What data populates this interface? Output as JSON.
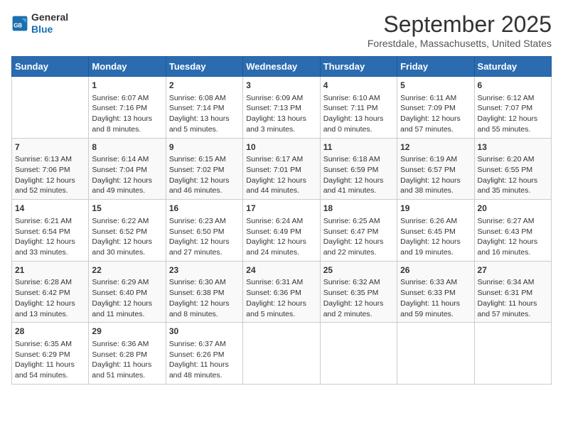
{
  "header": {
    "logo_line1": "General",
    "logo_line2": "Blue",
    "month_title": "September 2025",
    "location": "Forestdale, Massachusetts, United States"
  },
  "days_of_week": [
    "Sunday",
    "Monday",
    "Tuesday",
    "Wednesday",
    "Thursday",
    "Friday",
    "Saturday"
  ],
  "weeks": [
    [
      {
        "day": "",
        "info": ""
      },
      {
        "day": "1",
        "info": "Sunrise: 6:07 AM\nSunset: 7:16 PM\nDaylight: 13 hours\nand 8 minutes."
      },
      {
        "day": "2",
        "info": "Sunrise: 6:08 AM\nSunset: 7:14 PM\nDaylight: 13 hours\nand 5 minutes."
      },
      {
        "day": "3",
        "info": "Sunrise: 6:09 AM\nSunset: 7:13 PM\nDaylight: 13 hours\nand 3 minutes."
      },
      {
        "day": "4",
        "info": "Sunrise: 6:10 AM\nSunset: 7:11 PM\nDaylight: 13 hours\nand 0 minutes."
      },
      {
        "day": "5",
        "info": "Sunrise: 6:11 AM\nSunset: 7:09 PM\nDaylight: 12 hours\nand 57 minutes."
      },
      {
        "day": "6",
        "info": "Sunrise: 6:12 AM\nSunset: 7:07 PM\nDaylight: 12 hours\nand 55 minutes."
      }
    ],
    [
      {
        "day": "7",
        "info": "Sunrise: 6:13 AM\nSunset: 7:06 PM\nDaylight: 12 hours\nand 52 minutes."
      },
      {
        "day": "8",
        "info": "Sunrise: 6:14 AM\nSunset: 7:04 PM\nDaylight: 12 hours\nand 49 minutes."
      },
      {
        "day": "9",
        "info": "Sunrise: 6:15 AM\nSunset: 7:02 PM\nDaylight: 12 hours\nand 46 minutes."
      },
      {
        "day": "10",
        "info": "Sunrise: 6:17 AM\nSunset: 7:01 PM\nDaylight: 12 hours\nand 44 minutes."
      },
      {
        "day": "11",
        "info": "Sunrise: 6:18 AM\nSunset: 6:59 PM\nDaylight: 12 hours\nand 41 minutes."
      },
      {
        "day": "12",
        "info": "Sunrise: 6:19 AM\nSunset: 6:57 PM\nDaylight: 12 hours\nand 38 minutes."
      },
      {
        "day": "13",
        "info": "Sunrise: 6:20 AM\nSunset: 6:55 PM\nDaylight: 12 hours\nand 35 minutes."
      }
    ],
    [
      {
        "day": "14",
        "info": "Sunrise: 6:21 AM\nSunset: 6:54 PM\nDaylight: 12 hours\nand 33 minutes."
      },
      {
        "day": "15",
        "info": "Sunrise: 6:22 AM\nSunset: 6:52 PM\nDaylight: 12 hours\nand 30 minutes."
      },
      {
        "day": "16",
        "info": "Sunrise: 6:23 AM\nSunset: 6:50 PM\nDaylight: 12 hours\nand 27 minutes."
      },
      {
        "day": "17",
        "info": "Sunrise: 6:24 AM\nSunset: 6:49 PM\nDaylight: 12 hours\nand 24 minutes."
      },
      {
        "day": "18",
        "info": "Sunrise: 6:25 AM\nSunset: 6:47 PM\nDaylight: 12 hours\nand 22 minutes."
      },
      {
        "day": "19",
        "info": "Sunrise: 6:26 AM\nSunset: 6:45 PM\nDaylight: 12 hours\nand 19 minutes."
      },
      {
        "day": "20",
        "info": "Sunrise: 6:27 AM\nSunset: 6:43 PM\nDaylight: 12 hours\nand 16 minutes."
      }
    ],
    [
      {
        "day": "21",
        "info": "Sunrise: 6:28 AM\nSunset: 6:42 PM\nDaylight: 12 hours\nand 13 minutes."
      },
      {
        "day": "22",
        "info": "Sunrise: 6:29 AM\nSunset: 6:40 PM\nDaylight: 12 hours\nand 11 minutes."
      },
      {
        "day": "23",
        "info": "Sunrise: 6:30 AM\nSunset: 6:38 PM\nDaylight: 12 hours\nand 8 minutes."
      },
      {
        "day": "24",
        "info": "Sunrise: 6:31 AM\nSunset: 6:36 PM\nDaylight: 12 hours\nand 5 minutes."
      },
      {
        "day": "25",
        "info": "Sunrise: 6:32 AM\nSunset: 6:35 PM\nDaylight: 12 hours\nand 2 minutes."
      },
      {
        "day": "26",
        "info": "Sunrise: 6:33 AM\nSunset: 6:33 PM\nDaylight: 11 hours\nand 59 minutes."
      },
      {
        "day": "27",
        "info": "Sunrise: 6:34 AM\nSunset: 6:31 PM\nDaylight: 11 hours\nand 57 minutes."
      }
    ],
    [
      {
        "day": "28",
        "info": "Sunrise: 6:35 AM\nSunset: 6:29 PM\nDaylight: 11 hours\nand 54 minutes."
      },
      {
        "day": "29",
        "info": "Sunrise: 6:36 AM\nSunset: 6:28 PM\nDaylight: 11 hours\nand 51 minutes."
      },
      {
        "day": "30",
        "info": "Sunrise: 6:37 AM\nSunset: 6:26 PM\nDaylight: 11 hours\nand 48 minutes."
      },
      {
        "day": "",
        "info": ""
      },
      {
        "day": "",
        "info": ""
      },
      {
        "day": "",
        "info": ""
      },
      {
        "day": "",
        "info": ""
      }
    ]
  ]
}
